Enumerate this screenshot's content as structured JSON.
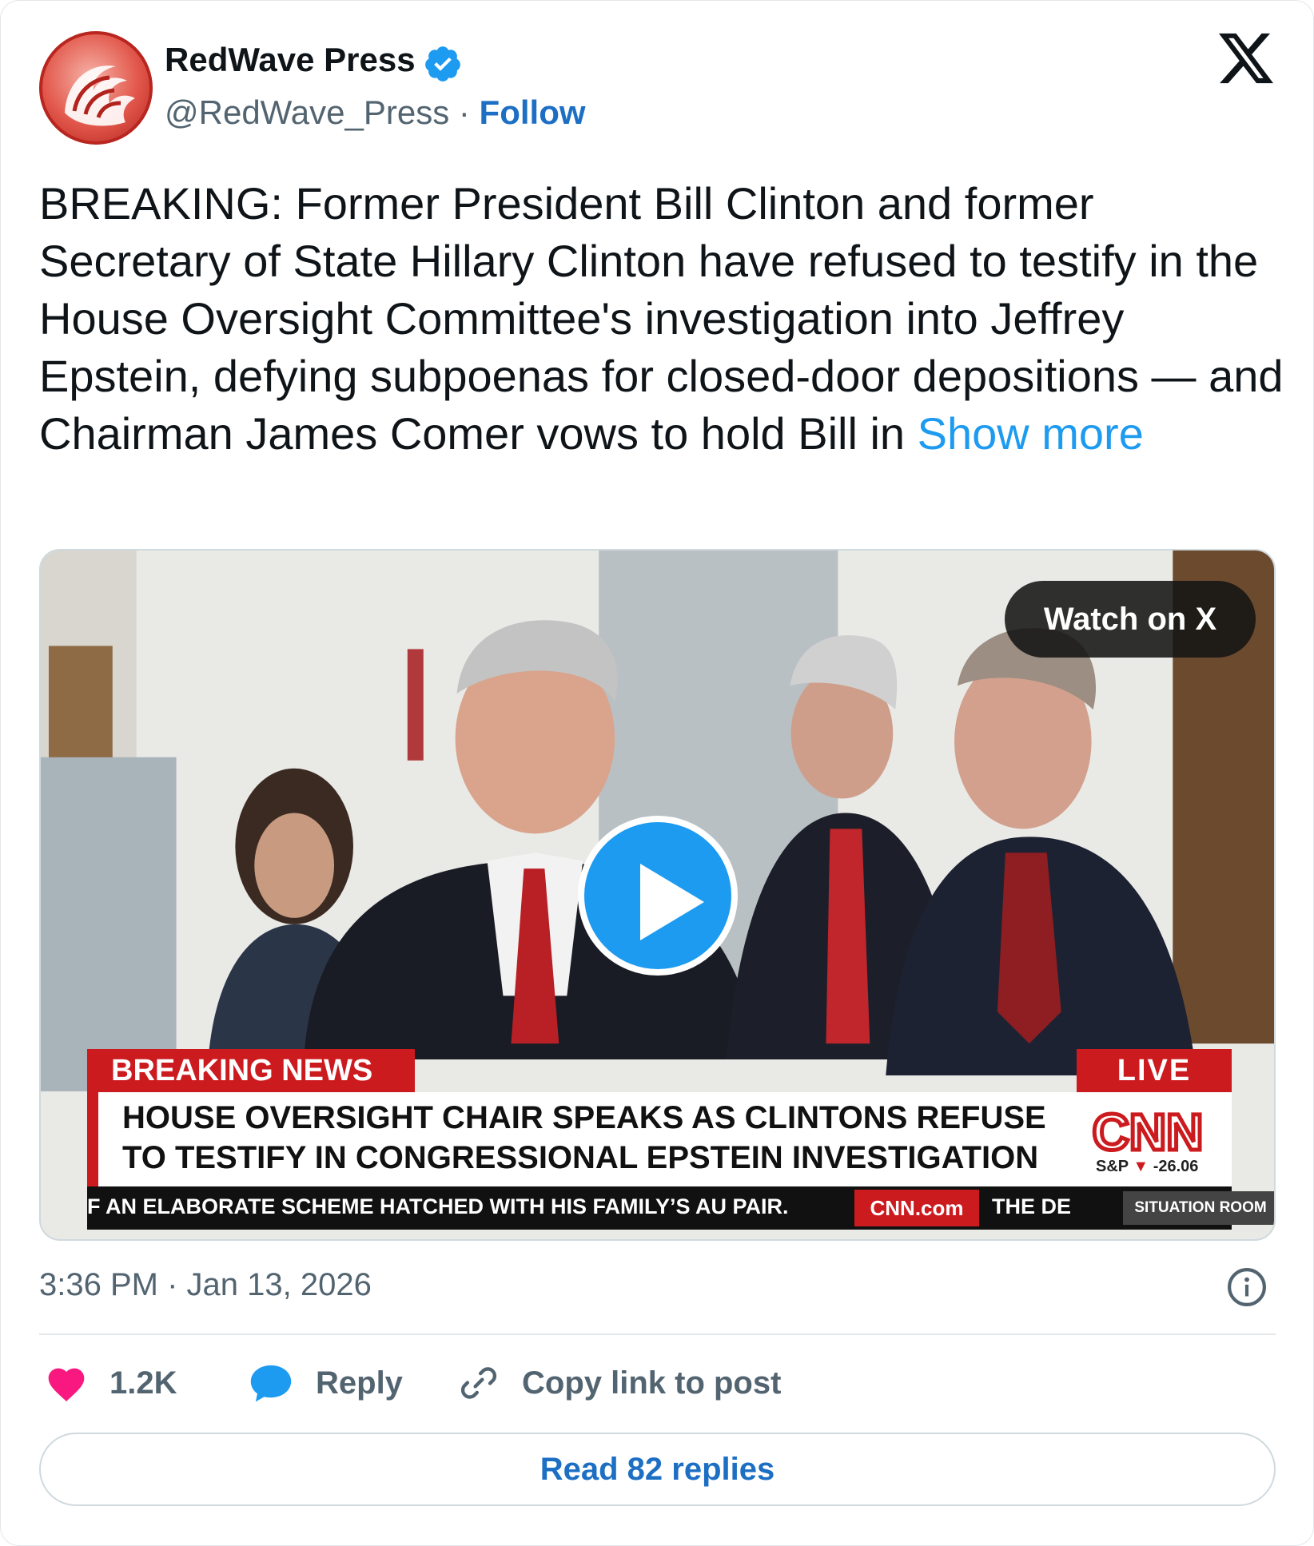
{
  "author": {
    "name": "RedWave Press",
    "handle": "@RedWave_Press",
    "separator": "·",
    "follow_label": "Follow"
  },
  "tweet": {
    "text": "BREAKING: Former President Bill Clinton and former Secretary of State Hillary Clinton have refused to testify in the House Oversight Committee's investigation into Jeffrey Epstein, defying subpoenas for closed-door depositions — and Chairman James Comer vows to hold Bill in ",
    "show_more": "Show more"
  },
  "media": {
    "watch_label": "Watch on X",
    "breaking_news": "BREAKING NEWS",
    "live": "LIVE",
    "headline_line1": "HOUSE OVERSIGHT CHAIR SPEAKS AS CLINTONS REFUSE",
    "headline_line2": "TO TESTIFY IN CONGRESSIONAL EPSTEIN INVESTIGATION",
    "cnn_logo": "CNN",
    "sp_label": "S&P",
    "sp_arrow": "▼",
    "sp_value": "-26.06",
    "ticker_text": "F AN ELABORATE SCHEME HATCHED WITH HIS FAMILY’S AU PAIR.",
    "cnn_com": "CNN.com",
    "ticker_next": "THE DE",
    "show_name": "SITUATION ROOM"
  },
  "meta": {
    "timestamp": "3:36 PM · Jan 13, 2026"
  },
  "actions": {
    "likes": "1.2K",
    "reply": "Reply",
    "copy_link": "Copy link to post"
  },
  "read_replies": "Read 82 replies",
  "icons": {
    "like": "heart-icon",
    "reply": "speech-bubble-icon",
    "copy": "link-icon",
    "info": "info-icon",
    "logo": "x-logo-icon",
    "verified": "verified-badge-icon"
  },
  "colors": {
    "link_blue": "#1d9bf0",
    "follow_blue": "#1d6fc4",
    "like_pink": "#f91880",
    "cnn_red": "#cc1b1f"
  }
}
